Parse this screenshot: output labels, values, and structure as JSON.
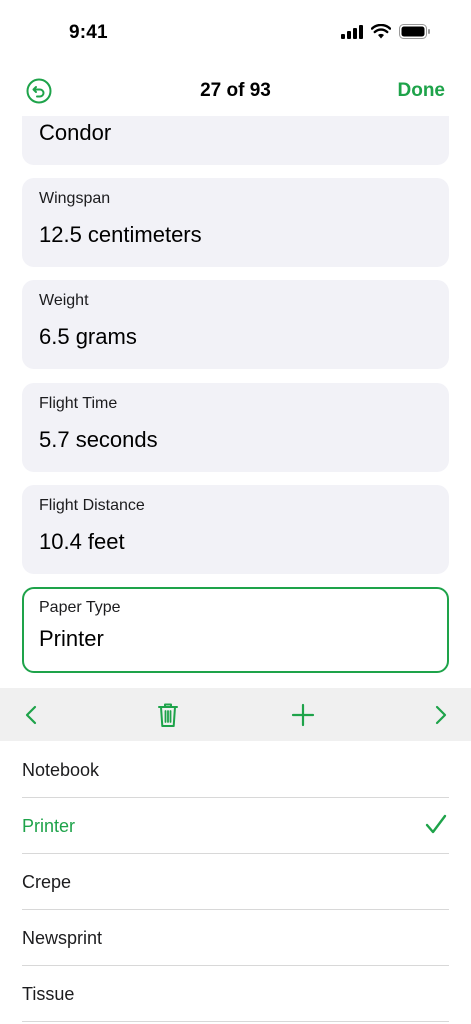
{
  "status_bar": {
    "time": "9:41"
  },
  "nav": {
    "title": "27 of 93",
    "done_label": "Done"
  },
  "fields": [
    {
      "label": "",
      "value": "Condor"
    },
    {
      "label": "Wingspan",
      "value": "12.5 centimeters"
    },
    {
      "label": "Weight",
      "value": "6.5 grams"
    },
    {
      "label": "Flight Time",
      "value": "5.7 seconds"
    },
    {
      "label": "Flight Distance",
      "value": "10.4 feet"
    },
    {
      "label": "Paper Type",
      "value": "Printer",
      "active": true
    }
  ],
  "toolbar": [
    "chevron-left-icon",
    "trash-icon",
    "plus-icon",
    "chevron-right-icon"
  ],
  "picker": {
    "options": [
      "Notebook",
      "Printer",
      "Crepe",
      "Newsprint",
      "Tissue"
    ],
    "selected": "Printer"
  },
  "colors": {
    "accent": "#1ea34a",
    "card_bg": "#f2f2f7",
    "toolbar_bg": "#f0f0f0"
  }
}
